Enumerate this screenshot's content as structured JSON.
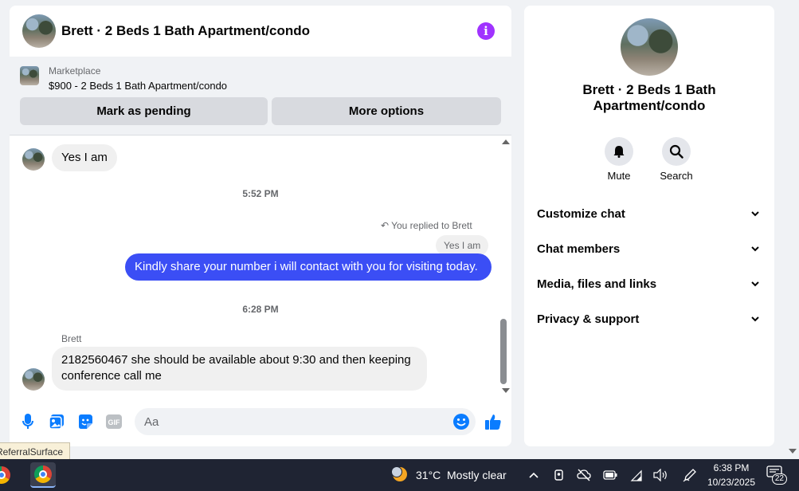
{
  "chat": {
    "title": "Brett · 2 Beds 1 Bath Apartment/condo",
    "info_icon": "info-icon",
    "marketplace": {
      "label": "Marketplace",
      "listing": "$900 - 2 Beds 1 Bath Apartment/condo",
      "pending_button": "Mark as pending",
      "options_button": "More options"
    },
    "messages": {
      "first_incoming": "Yes I am",
      "time_1": "5:52 PM",
      "reply_note": "You replied to Brett",
      "quoted": "Yes I am",
      "outgoing": "Kindly share your number i will contact with you for visiting today.",
      "time_2": "6:28 PM",
      "sender": "Brett",
      "last_incoming": "2182560467 she should be available about 9:30 and then keeping conference call me"
    },
    "composer": {
      "placeholder": "Aa",
      "value": ""
    },
    "colors": {
      "outgoing_bubble": "#3b4ef5",
      "accent": "#0a7cff",
      "info": "#a033ff"
    }
  },
  "info_panel": {
    "name": "Brett · 2 Beds 1 Bath Apartment/condo",
    "mute_label": "Mute",
    "search_label": "Search",
    "sections": [
      "Customize chat",
      "Chat members",
      "Media, files and links",
      "Privacy & support"
    ]
  },
  "status_tooltip": "ReferralSurface...",
  "taskbar": {
    "weather_temp": "31°C",
    "weather_desc": "Mostly clear",
    "time": "6:38 PM",
    "date": "10/23/2025",
    "notifications": "22"
  }
}
